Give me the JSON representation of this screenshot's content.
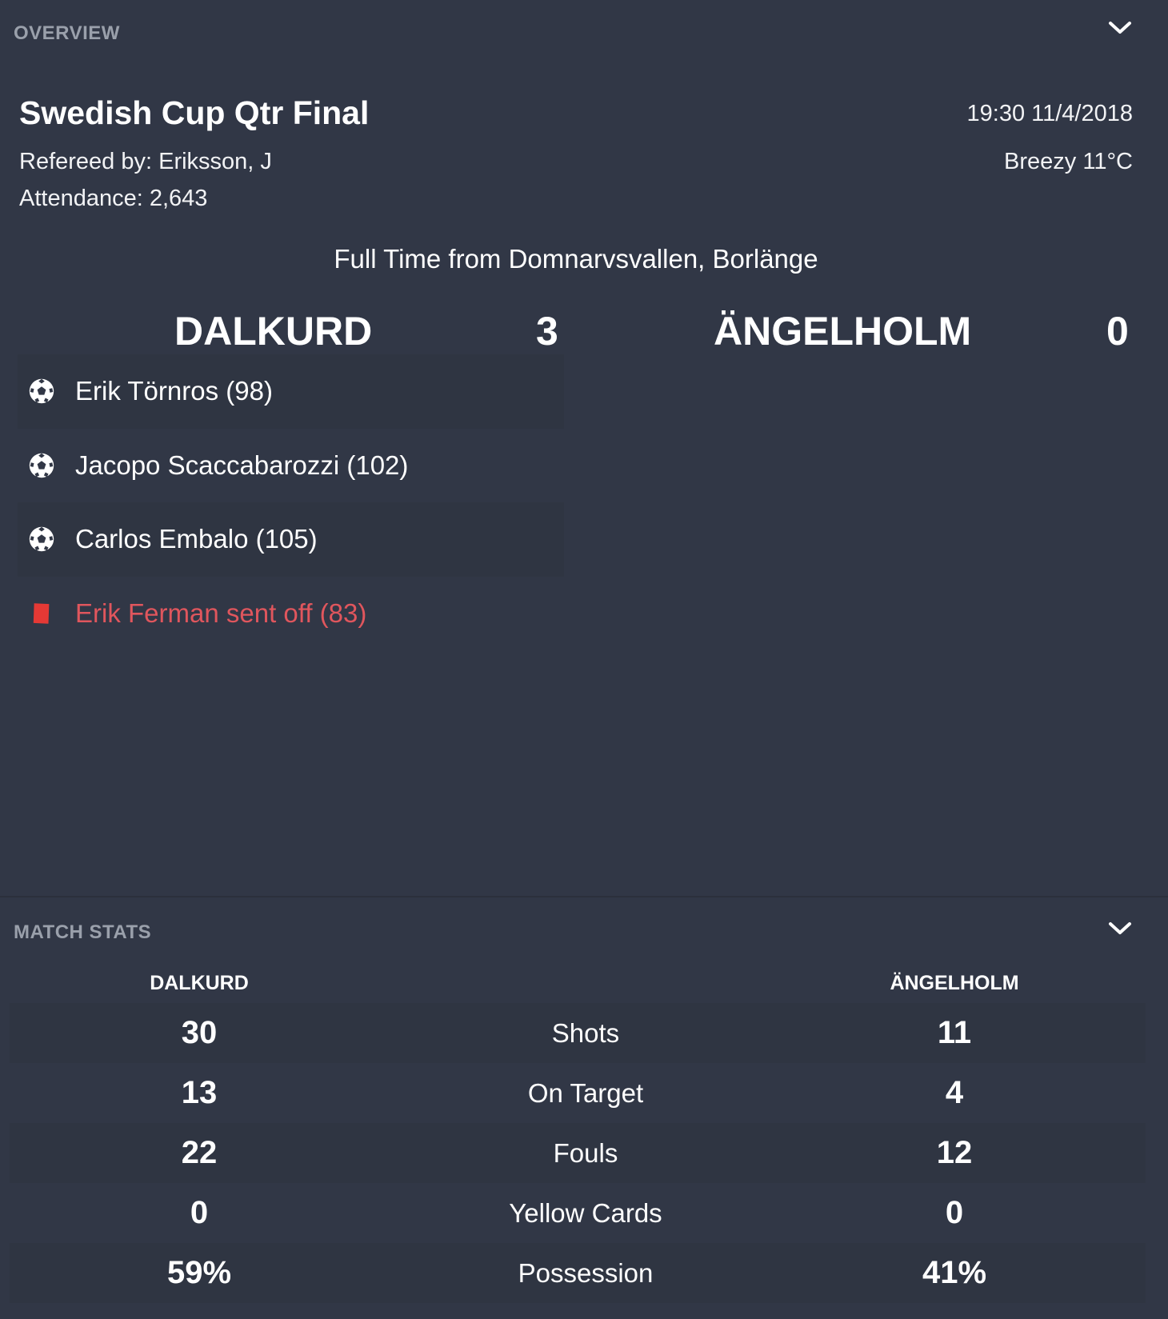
{
  "overview": {
    "section_title": "OVERVIEW",
    "competition": "Swedish Cup Qtr Final",
    "referee": "Refereed by: Eriksson, J",
    "attendance": "Attendance: 2,643",
    "kickoff": "19:30 11/4/2018",
    "weather": "Breezy 11°C",
    "venue_line": "Full Time from Domnarvsvallen, Borlänge",
    "home_team": "DALKURD",
    "home_score": "3",
    "away_team": "ÄNGELHOLM",
    "away_score": "0",
    "events": [
      {
        "type": "goal",
        "icon": "football-icon",
        "text": "Erik Törnros (98)"
      },
      {
        "type": "goal",
        "icon": "football-icon",
        "text": "Jacopo Scaccabarozzi (102)"
      },
      {
        "type": "goal",
        "icon": "football-icon",
        "text": "Carlos Embalo (105)"
      },
      {
        "type": "red-card",
        "icon": "red-card-icon",
        "text": "Erik Ferman sent off (83)"
      }
    ]
  },
  "match_stats": {
    "section_title": "MATCH STATS",
    "home_team": "DALKURD",
    "away_team": "ÄNGELHOLM",
    "rows": [
      {
        "label": "Shots",
        "home": "30",
        "away": "11"
      },
      {
        "label": "On Target",
        "home": "13",
        "away": "4"
      },
      {
        "label": "Fouls",
        "home": "22",
        "away": "12"
      },
      {
        "label": "Yellow Cards",
        "home": "0",
        "away": "0"
      },
      {
        "label": "Possession",
        "home": "59%",
        "away": "41%"
      }
    ]
  },
  "icons": {
    "collapse": "chevron-down-icon"
  },
  "colors": {
    "background": "#313746",
    "row_shade": "#2f3542",
    "header_text": "#9aa0ab",
    "red_card": "#e0565d"
  }
}
